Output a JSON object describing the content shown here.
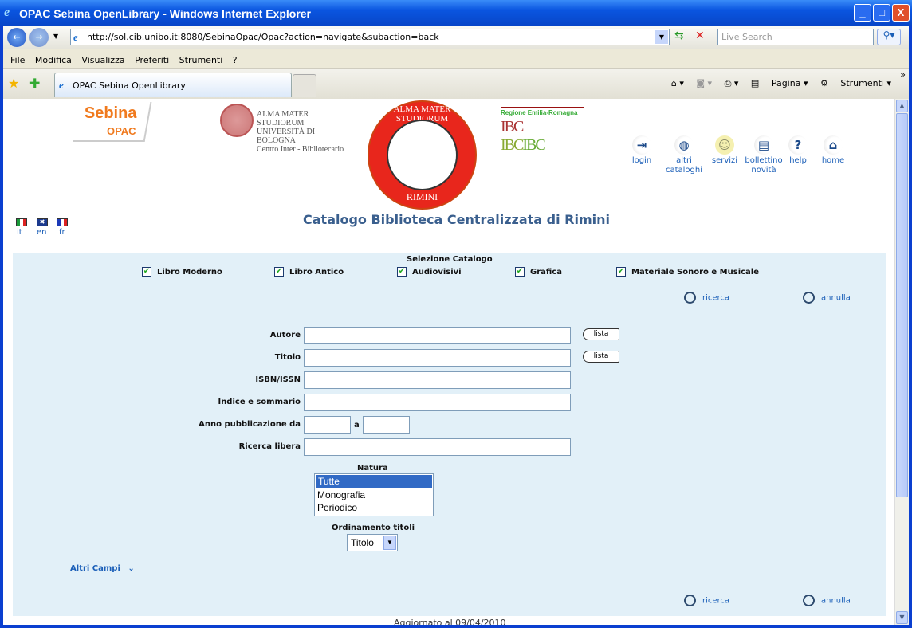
{
  "window": {
    "title": "OPAC Sebina OpenLibrary - Windows Internet Explorer",
    "minimize": "_",
    "maximize": "□",
    "close": "X"
  },
  "browser": {
    "url": "http://sol.cib.unibo.it:8080/SebinaOpac/Opac?action=navigate&subaction=back",
    "search_placeholder": "Live Search",
    "menu": [
      "File",
      "Modifica",
      "Visualizza",
      "Preferiti",
      "Strumenti",
      "?"
    ],
    "tab_title": "OPAC Sebina OpenLibrary",
    "tools": {
      "page": "Pagina",
      "tools": "Strumenti"
    }
  },
  "header": {
    "logo_sebina": "Sebina",
    "logo_opac": "OPAC",
    "alma_lines": [
      "ALMA MATER STUDIORUM",
      "UNIVERSITÀ DI BOLOGNA",
      "Centro Inter - Bibliotecario"
    ],
    "seal_top": "ALMA MATER STUDIORUM",
    "seal_bottom": "RIMINI",
    "ibc_region": "Regione Emilia-Romagna",
    "ibc_logo": "IBC",
    "title": "Catalogo Biblioteca Centralizzata di Rimini",
    "nav": [
      {
        "label": "login",
        "icon": "login-door-icon"
      },
      {
        "label": "altri\ncataloghi",
        "icon": "globe-icon"
      },
      {
        "label": "servizi",
        "icon": "smiley-icon"
      },
      {
        "label": "bollettino\nnovità",
        "icon": "newspaper-icon"
      },
      {
        "label": "help",
        "icon": "question-icon"
      },
      {
        "label": "home",
        "icon": "home-icon"
      }
    ],
    "languages": [
      "it",
      "en",
      "fr"
    ]
  },
  "form": {
    "catalog_heading": "Selezione Catalogo",
    "catalogs": [
      {
        "label": "Libro Moderno",
        "checked": true
      },
      {
        "label": "Libro Antico",
        "checked": true
      },
      {
        "label": "Audiovisivi",
        "checked": true
      },
      {
        "label": "Grafica",
        "checked": true
      },
      {
        "label": "Materiale Sonoro e Musicale",
        "checked": true
      }
    ],
    "search": "ricerca",
    "cancel": "annulla",
    "fields": {
      "autore": "Autore",
      "titolo": "Titolo",
      "isbn": "ISBN/ISSN",
      "indice": "Indice e sommario",
      "anno_da": "Anno pubblicazione da",
      "anno_a": "a",
      "libera": "Ricerca libera"
    },
    "values": {
      "autore": "",
      "titolo": "",
      "isbn": "",
      "indice": "",
      "anno_da": "",
      "anno_a": "",
      "libera": ""
    },
    "lista": "lista",
    "natura_label": "Natura",
    "natura_options": [
      "Tutte",
      "Monografia",
      "Periodico"
    ],
    "natura_selected": "Tutte",
    "ordinamento_label": "Ordinamento titoli",
    "ordinamento_value": "Titolo",
    "altri_campi": "Altri Campi"
  },
  "footer": {
    "updated": "Aggiornato al 09/04/2010"
  }
}
